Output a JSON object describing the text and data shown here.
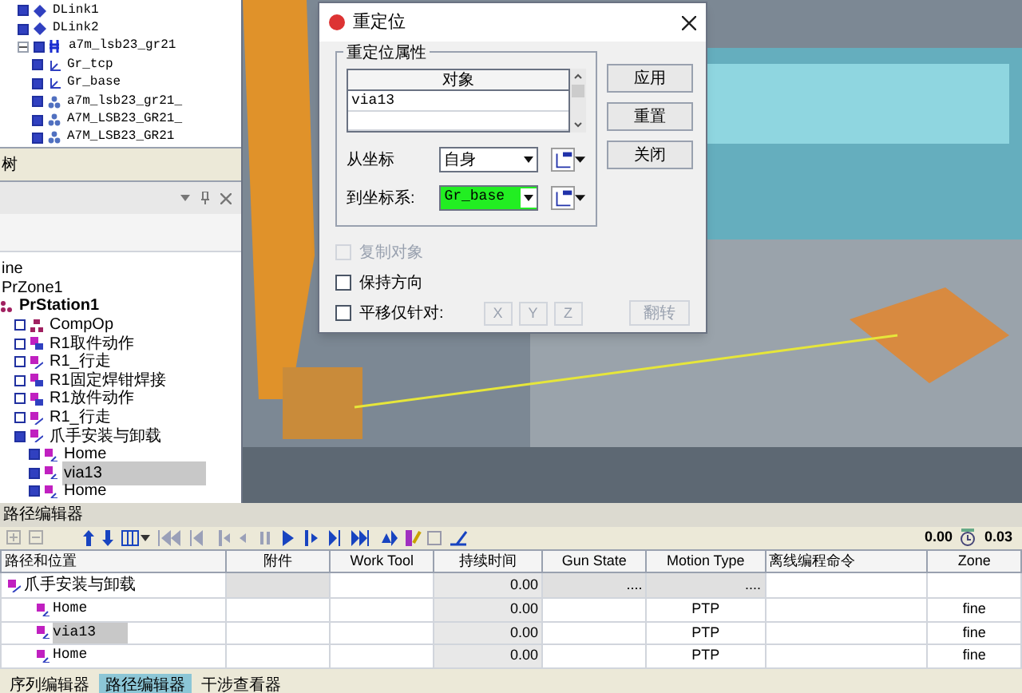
{
  "object_tree": {
    "items": [
      {
        "label": "DLink1",
        "kind": "link",
        "checked": true
      },
      {
        "label": "DLink2",
        "kind": "link",
        "checked": true
      },
      {
        "label": "a7m_lsb23_gr21",
        "kind": "robot",
        "checked": true,
        "expanded": true,
        "children": [
          {
            "label": "Gr_tcp",
            "kind": "frame",
            "checked": true
          },
          {
            "label": "Gr_base",
            "kind": "frame",
            "checked": true
          },
          {
            "label": "a7m_lsb23_gr21_",
            "kind": "part",
            "checked": true
          },
          {
            "label": "A7M_LSB23_GR21_",
            "kind": "part",
            "checked": true
          },
          {
            "label": "A7M_LSB23_GR21",
            "kind": "part",
            "checked": true
          }
        ]
      }
    ]
  },
  "tree_tab": "树",
  "operation_tree": {
    "items": [
      {
        "label": "ine",
        "kind": "plain"
      },
      {
        "label": "PrZone1",
        "kind": "plain"
      },
      {
        "label": "PrStation1",
        "kind": "station",
        "children": [
          {
            "label": "CompOp",
            "kind": "compound",
            "checked": false,
            "selected": false
          },
          {
            "label": "R1取件动作",
            "kind": "op",
            "checked": false,
            "selected": false
          },
          {
            "label": "R1_行走",
            "kind": "path",
            "checked": false,
            "selected": false
          },
          {
            "label": "R1固定焊钳焊接",
            "kind": "op",
            "checked": false,
            "selected": false
          },
          {
            "label": "R1放件动作",
            "kind": "op",
            "checked": false,
            "selected": false
          },
          {
            "label": "R1_行走",
            "kind": "path",
            "checked": false,
            "selected": false
          },
          {
            "label": "爪手安装与卸载",
            "kind": "path",
            "checked": true,
            "selected": false,
            "children": [
              {
                "label": "Home",
                "kind": "loc",
                "checked": true,
                "selected": false
              },
              {
                "label": "via13",
                "kind": "loc",
                "checked": true,
                "selected": true
              },
              {
                "label": "Home",
                "kind": "loc",
                "checked": true,
                "selected": false
              }
            ]
          }
        ]
      }
    ]
  },
  "dialog": {
    "title": "重定位",
    "group": "重定位属性",
    "column": "对象",
    "rows": [
      "via13"
    ],
    "from_label": "从坐标",
    "from_value": "自身",
    "to_label": "到坐标系:",
    "to_value": "Gr_base",
    "options": [
      {
        "label": "复制对象",
        "checked": false,
        "disabled": true
      },
      {
        "label": "保持方向",
        "checked": false,
        "disabled": false
      },
      {
        "label": "平移仅针对:",
        "checked": false,
        "disabled": false
      }
    ],
    "axis_buttons": [
      {
        "label": "X",
        "disabled": true
      },
      {
        "label": "Y",
        "disabled": true
      },
      {
        "label": "Z",
        "disabled": true
      }
    ],
    "flip_button": {
      "label": "翻转",
      "disabled": true
    },
    "buttons": [
      "应用",
      "重置",
      "关闭"
    ]
  },
  "path_editor": {
    "title": "路径编辑器",
    "time": "0.00",
    "step": "0.03",
    "columns": [
      "路径和位置",
      "附件",
      "Work Tool",
      "持续时间",
      "Gun State",
      "Motion Type",
      "离线编程命令",
      "Zone"
    ],
    "rows": [
      {
        "kind": "path",
        "selected": false,
        "cells": [
          "爪手安装与卸载",
          "",
          "",
          "0.00",
          "....",
          "....",
          "",
          ""
        ]
      },
      {
        "kind": "loc",
        "selected": false,
        "cells": [
          "Home",
          "",
          "",
          "0.00",
          "",
          "PTP",
          "",
          "fine"
        ]
      },
      {
        "kind": "loc",
        "selected": true,
        "cells": [
          "via13",
          "",
          "",
          "0.00",
          "",
          "PTP",
          "",
          "fine"
        ]
      },
      {
        "kind": "loc",
        "selected": false,
        "cells": [
          "Home",
          "",
          "",
          "0.00",
          "",
          "PTP",
          "",
          "fine"
        ]
      }
    ]
  },
  "bottom_tabs": [
    {
      "label": "序列编辑器",
      "selected": false
    },
    {
      "label": "路径编辑器",
      "selected": true
    },
    {
      "label": "干涉查看器",
      "selected": false
    }
  ]
}
